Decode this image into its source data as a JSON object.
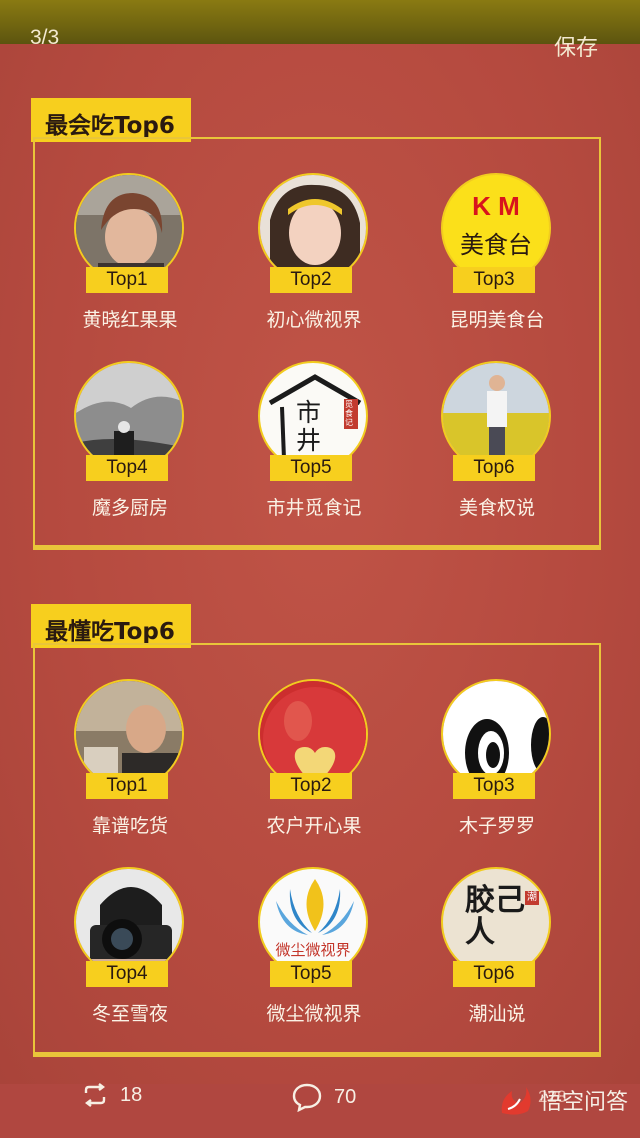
{
  "header": {
    "page_counter": "3/3",
    "save_label": "保存"
  },
  "sections": [
    {
      "title": "最会吃Top6",
      "items": [
        {
          "rank": "Top1",
          "name": "黄晓红果果",
          "avatar_icon": "person-photo-avatar"
        },
        {
          "rank": "Top2",
          "name": "初心微视界",
          "avatar_icon": "woman-photo-avatar"
        },
        {
          "rank": "Top3",
          "name": "昆明美食台",
          "avatar_icon": "km-logo-avatar",
          "avatar_text": "K M",
          "avatar_subtext": "美食台"
        },
        {
          "rank": "Top4",
          "name": "魔多厨房",
          "avatar_icon": "grayscale-scene-avatar"
        },
        {
          "rank": "Top5",
          "name": "市井觅食记",
          "avatar_icon": "calligraphy-logo-avatar",
          "avatar_text": "市井",
          "avatar_stamp": "觅食记"
        },
        {
          "rank": "Top6",
          "name": "美食权说",
          "avatar_icon": "man-in-field-avatar"
        }
      ]
    },
    {
      "title": "最懂吃Top6",
      "items": [
        {
          "rank": "Top1",
          "name": "靠谱吃货",
          "avatar_icon": "man-photo-avatar"
        },
        {
          "rank": "Top2",
          "name": "农户开心果",
          "avatar_icon": "apple-avatar"
        },
        {
          "rank": "Top3",
          "name": "木子罗罗",
          "avatar_icon": "cartoon-eye-avatar"
        },
        {
          "rank": "Top4",
          "name": "冬至雪夜",
          "avatar_icon": "camera-person-avatar"
        },
        {
          "rank": "Top5",
          "name": "微尘微视界",
          "avatar_icon": "lotus-logo-avatar",
          "avatar_text": "微尘微视界"
        },
        {
          "rank": "Top6",
          "name": "潮汕说",
          "avatar_icon": "calligraphy-seal-avatar",
          "avatar_text": "胶己人",
          "avatar_stamp": "潮"
        }
      ]
    }
  ],
  "footer": {
    "repost_count": "18",
    "comment_count": "70",
    "like_count": "228",
    "brand": "悟空问答"
  },
  "colors": {
    "background": "#b44a3f",
    "accent_yellow": "#f7cf1e",
    "frame": "#e9c53a"
  }
}
